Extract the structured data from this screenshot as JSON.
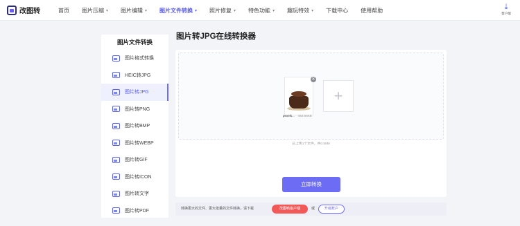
{
  "header": {
    "logo_text": "改图转",
    "nav": [
      {
        "label": "首页",
        "caret": false,
        "active": false
      },
      {
        "label": "图片压缩",
        "caret": true,
        "active": false
      },
      {
        "label": "图片编辑",
        "caret": true,
        "active": false
      },
      {
        "label": "图片文件转换",
        "caret": true,
        "active": true
      },
      {
        "label": "照片修复",
        "caret": true,
        "active": false
      },
      {
        "label": "特色功能",
        "caret": true,
        "active": false
      },
      {
        "label": "趣玩特效",
        "caret": true,
        "active": false
      },
      {
        "label": "下载中心",
        "caret": false,
        "active": false
      },
      {
        "label": "使用帮助",
        "caret": false,
        "active": false
      }
    ],
    "client_label": "客户端",
    "accent": "#5b5ef0"
  },
  "sidebar": {
    "title": "图片文件转换",
    "items": [
      {
        "label": "图片格式转换",
        "active": false
      },
      {
        "label": "HEIC转JPG",
        "active": false
      },
      {
        "label": "图片转JPG",
        "active": true
      },
      {
        "label": "图片转PNG",
        "active": false
      },
      {
        "label": "图片转BMP",
        "active": false
      },
      {
        "label": "图片转WEBP",
        "active": false
      },
      {
        "label": "图片转GIF",
        "active": false
      },
      {
        "label": "图片转ICON",
        "active": false
      },
      {
        "label": "图片转文字",
        "active": false
      },
      {
        "label": "图片转PDF",
        "active": false
      }
    ]
  },
  "main": {
    "title": "图片转JPG在线转换器",
    "file": {
      "name": "pexels...",
      "size": "563.56KB"
    },
    "upload_hint": "已上传1个文件，共0.55M",
    "convert_label": "立即转换"
  },
  "bottom": {
    "text": "转换更大的文件、更大批量的文件转换，请下载",
    "download_label": "改图鸭客户端",
    "or": "或",
    "upgrade_label": "升级账户"
  }
}
